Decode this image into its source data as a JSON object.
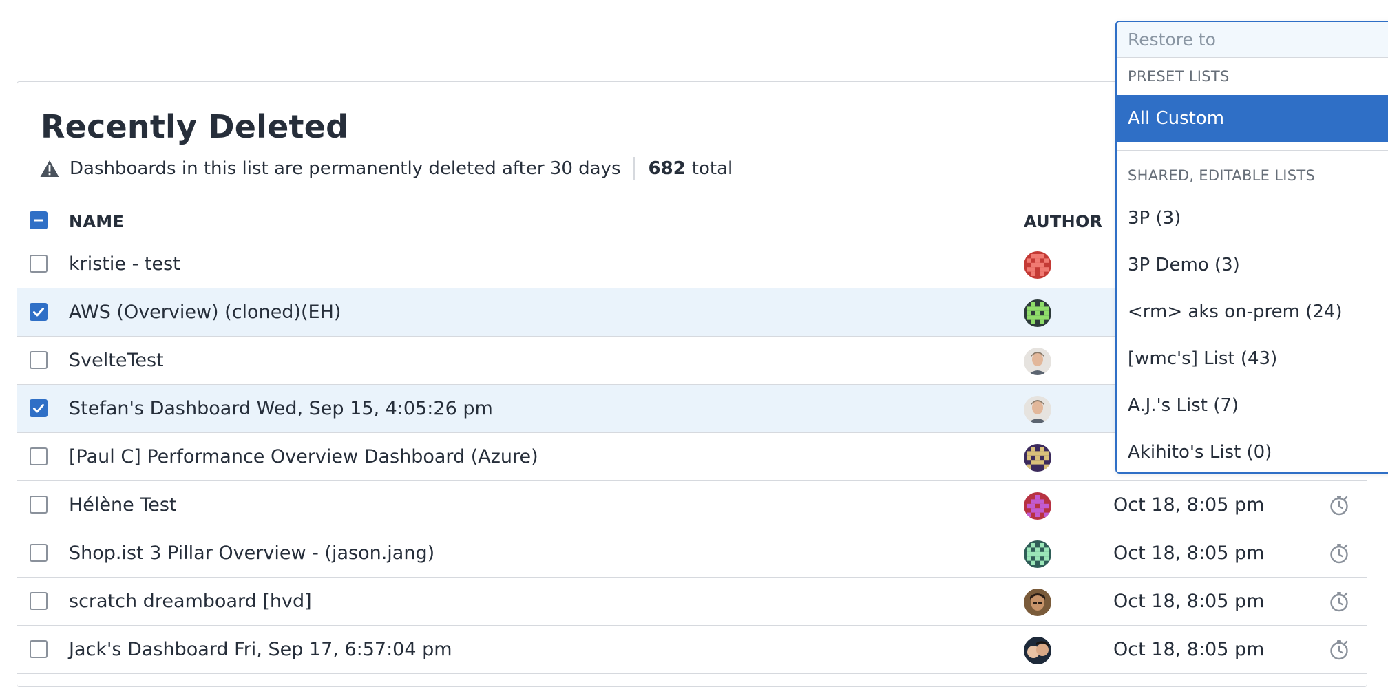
{
  "page": {
    "title": "Recently Deleted",
    "notice": "Dashboards in this list are permanently deleted after 30 days",
    "total_count": "682",
    "total_label": "total"
  },
  "table": {
    "headers": {
      "name": "NAME",
      "author": "AUTHOR"
    },
    "rows": [
      {
        "name": "kristie - test",
        "date": "",
        "checked": false,
        "avatar": "red-pixel"
      },
      {
        "name": "AWS (Overview) (cloned)(EH)",
        "date": "",
        "checked": true,
        "avatar": "green-pixel"
      },
      {
        "name": "SvelteTest",
        "date": "",
        "checked": false,
        "avatar": "photo-man"
      },
      {
        "name": "Stefan's Dashboard Wed, Sep 15, 4:05:26 pm",
        "date": "",
        "checked": true,
        "avatar": "photo-man"
      },
      {
        "name": "[Paul C] Performance Overview Dashboard (Azure)",
        "date": "",
        "checked": false,
        "avatar": "purple-pixel"
      },
      {
        "name": "Hélène Test",
        "date": "Oct 18, 8:05 pm",
        "checked": false,
        "avatar": "magenta-pixel"
      },
      {
        "name": "Shop.ist 3 Pillar Overview - (jason.jang)",
        "date": "Oct 18, 8:05 pm",
        "checked": false,
        "avatar": "teal-pixel"
      },
      {
        "name": "scratch dreamboard [hvd]",
        "date": "Oct 18, 8:05 pm",
        "checked": false,
        "avatar": "photo-person"
      },
      {
        "name": "Jack's Dashboard Fri, Sep 17, 6:57:04 pm",
        "date": "Oct 18, 8:05 pm",
        "checked": false,
        "avatar": "photo-couple"
      }
    ]
  },
  "restore_dropdown": {
    "placeholder": "Restore to",
    "groups": [
      {
        "label": "PRESET LISTS",
        "items": [
          {
            "label": "All Custom",
            "active": true
          }
        ]
      },
      {
        "label": "SHARED, EDITABLE LISTS",
        "items": [
          {
            "label": "3P (3)"
          },
          {
            "label": "3P Demo (3)"
          },
          {
            "label": "<rm> aks on-prem (24)"
          },
          {
            "label": "[wmc's] List (43)"
          },
          {
            "label": "A.J.'s List (7)"
          },
          {
            "label": "Akihito's List (0)"
          }
        ]
      }
    ]
  },
  "colors": {
    "accent": "#2f6fc6",
    "selected_row": "#eaf3fb",
    "border": "#d6d9de",
    "text": "#262e3a"
  },
  "icons": {
    "warning": "warning-triangle-icon",
    "checkbox_checked": "checkmark-icon",
    "checkbox_partial": "minus-icon",
    "restore": "stopwatch-icon"
  }
}
